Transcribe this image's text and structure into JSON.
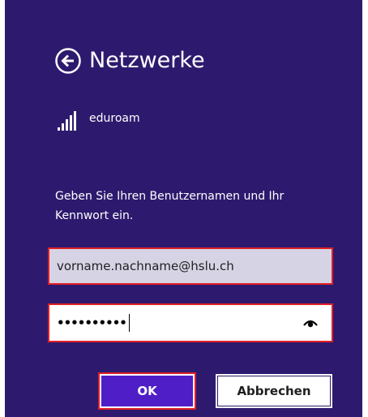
{
  "header": {
    "title": "Netzwerke",
    "back_icon": "arrow-left-circle-icon"
  },
  "network": {
    "name": "eduroam",
    "signal_icon": "wifi-signal-bars-icon"
  },
  "prompt": {
    "text": "Geben Sie Ihren Benutzernamen und Ihr Kennwort ein."
  },
  "username": {
    "value": "vorname.nachname@hslu.ch"
  },
  "password": {
    "masked_value": "••••••••••",
    "reveal_icon": "eye-icon"
  },
  "buttons": {
    "ok_label": "OK",
    "cancel_label": "Abbrechen"
  },
  "colors": {
    "background": "#2d1a6e",
    "accent": "#4f1ec7",
    "highlight_border": "#e01f26"
  }
}
